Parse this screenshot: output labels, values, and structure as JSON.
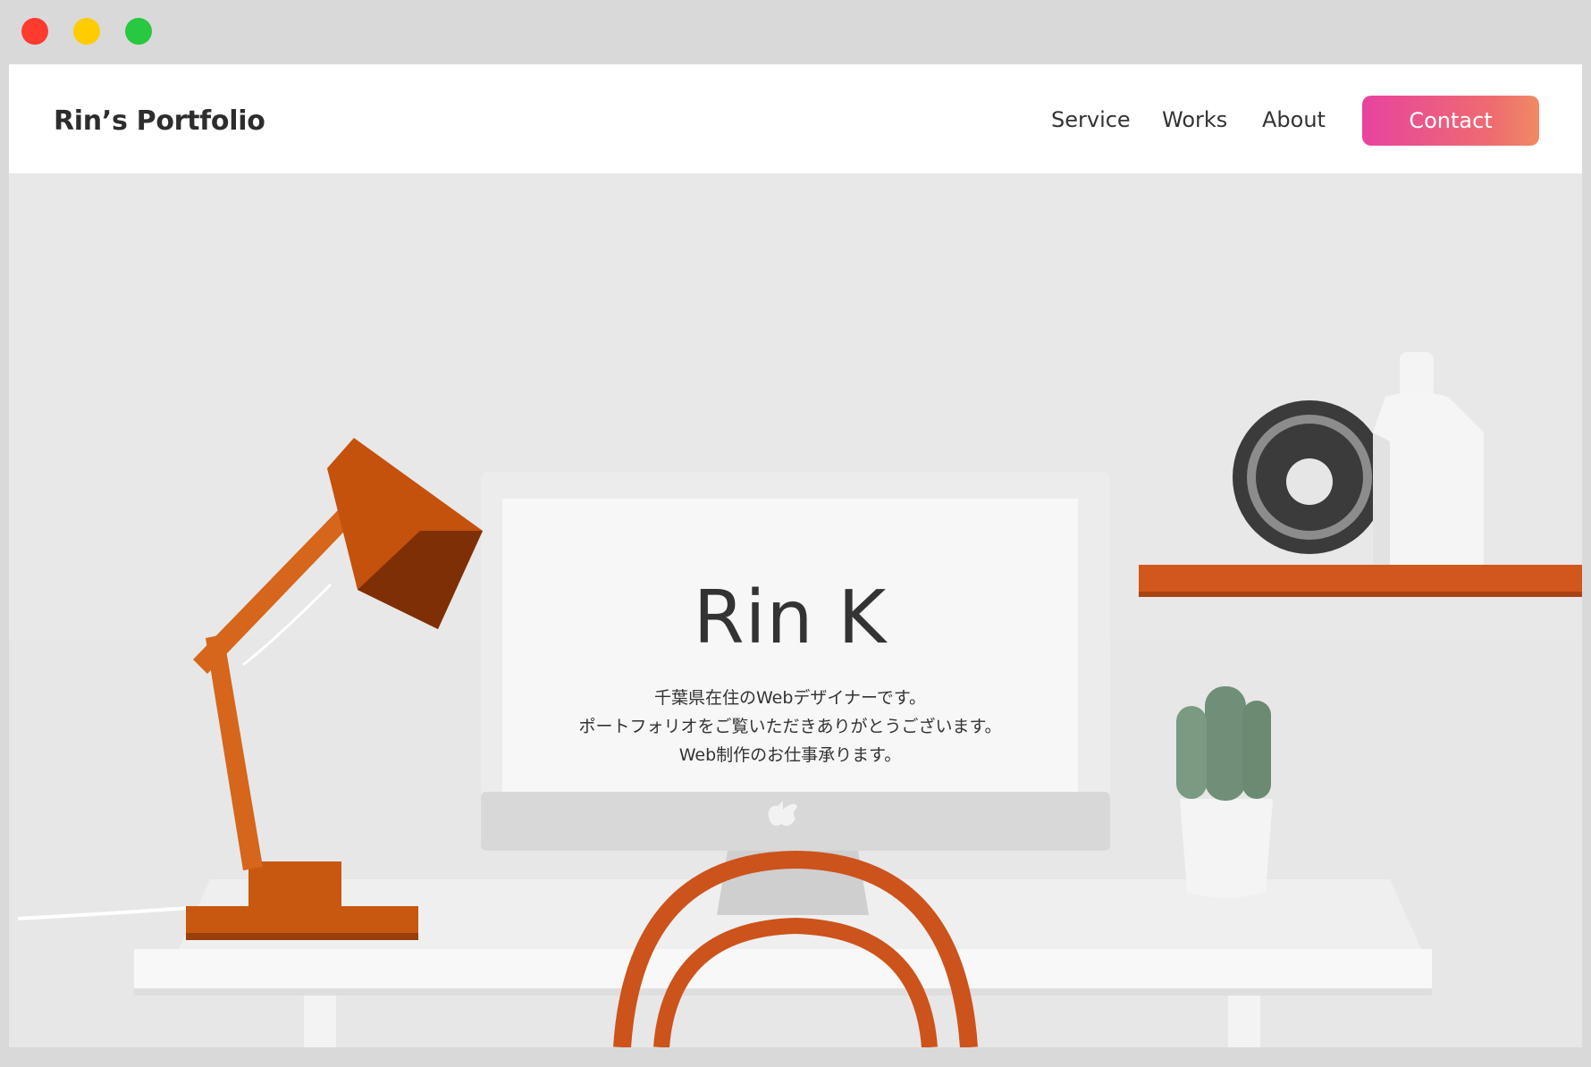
{
  "site": {
    "brand": "Rin’s Portfolio"
  },
  "nav": {
    "items": [
      "Service",
      "Works",
      "About"
    ],
    "contact_label": "Contact"
  },
  "hero": {
    "name": "Rin K",
    "lines": [
      "千葉県在住のWebデザイナーです。",
      "ポートフォリオをご覧いただきありがとうございます。",
      "Web制作のお仕事承ります。"
    ]
  },
  "colors": {
    "accent_start": "#e8439f",
    "accent_end": "#f08a63",
    "lamp_orange": "#c8580f",
    "shelf_orange": "#d2571c"
  }
}
